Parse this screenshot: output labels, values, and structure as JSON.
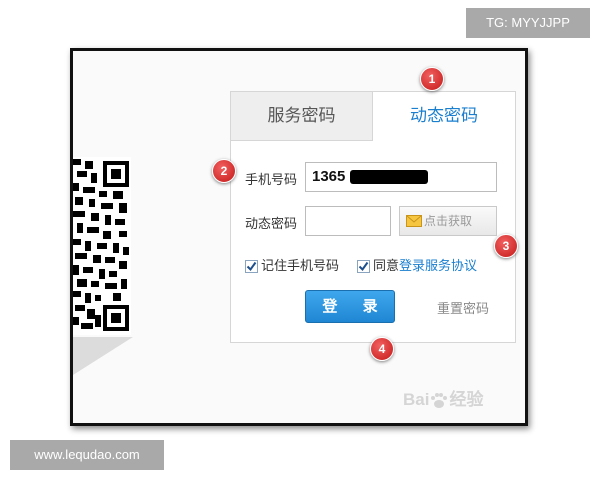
{
  "overlay": {
    "tg_label": "TG: MYYJJPP",
    "site_url": "www.lequdao.com"
  },
  "login_panel": {
    "tabs": [
      {
        "label": "服务密码",
        "active": false
      },
      {
        "label": "动态密码",
        "active": true
      }
    ],
    "phone_label": "手机号码",
    "phone_value": "1365",
    "code_label": "动态密码",
    "code_value": "",
    "get_code_label": "点击获取",
    "get_code_icon": "envelope-icon",
    "remember_label": "记住手机号码",
    "remember_checked": true,
    "agree_prefix": "同意",
    "agree_link": "登录服务协议",
    "agree_checked": true,
    "login_label": "登 录",
    "reset_label": "重置密码"
  },
  "annotations": {
    "badges": [
      "1",
      "2",
      "3",
      "4"
    ]
  },
  "watermark": {
    "text_left": "Bai",
    "text_right": "经验"
  },
  "colors": {
    "accent": "#1a7fcf",
    "badge": "#d42020",
    "login_button": "#2a90dc"
  }
}
